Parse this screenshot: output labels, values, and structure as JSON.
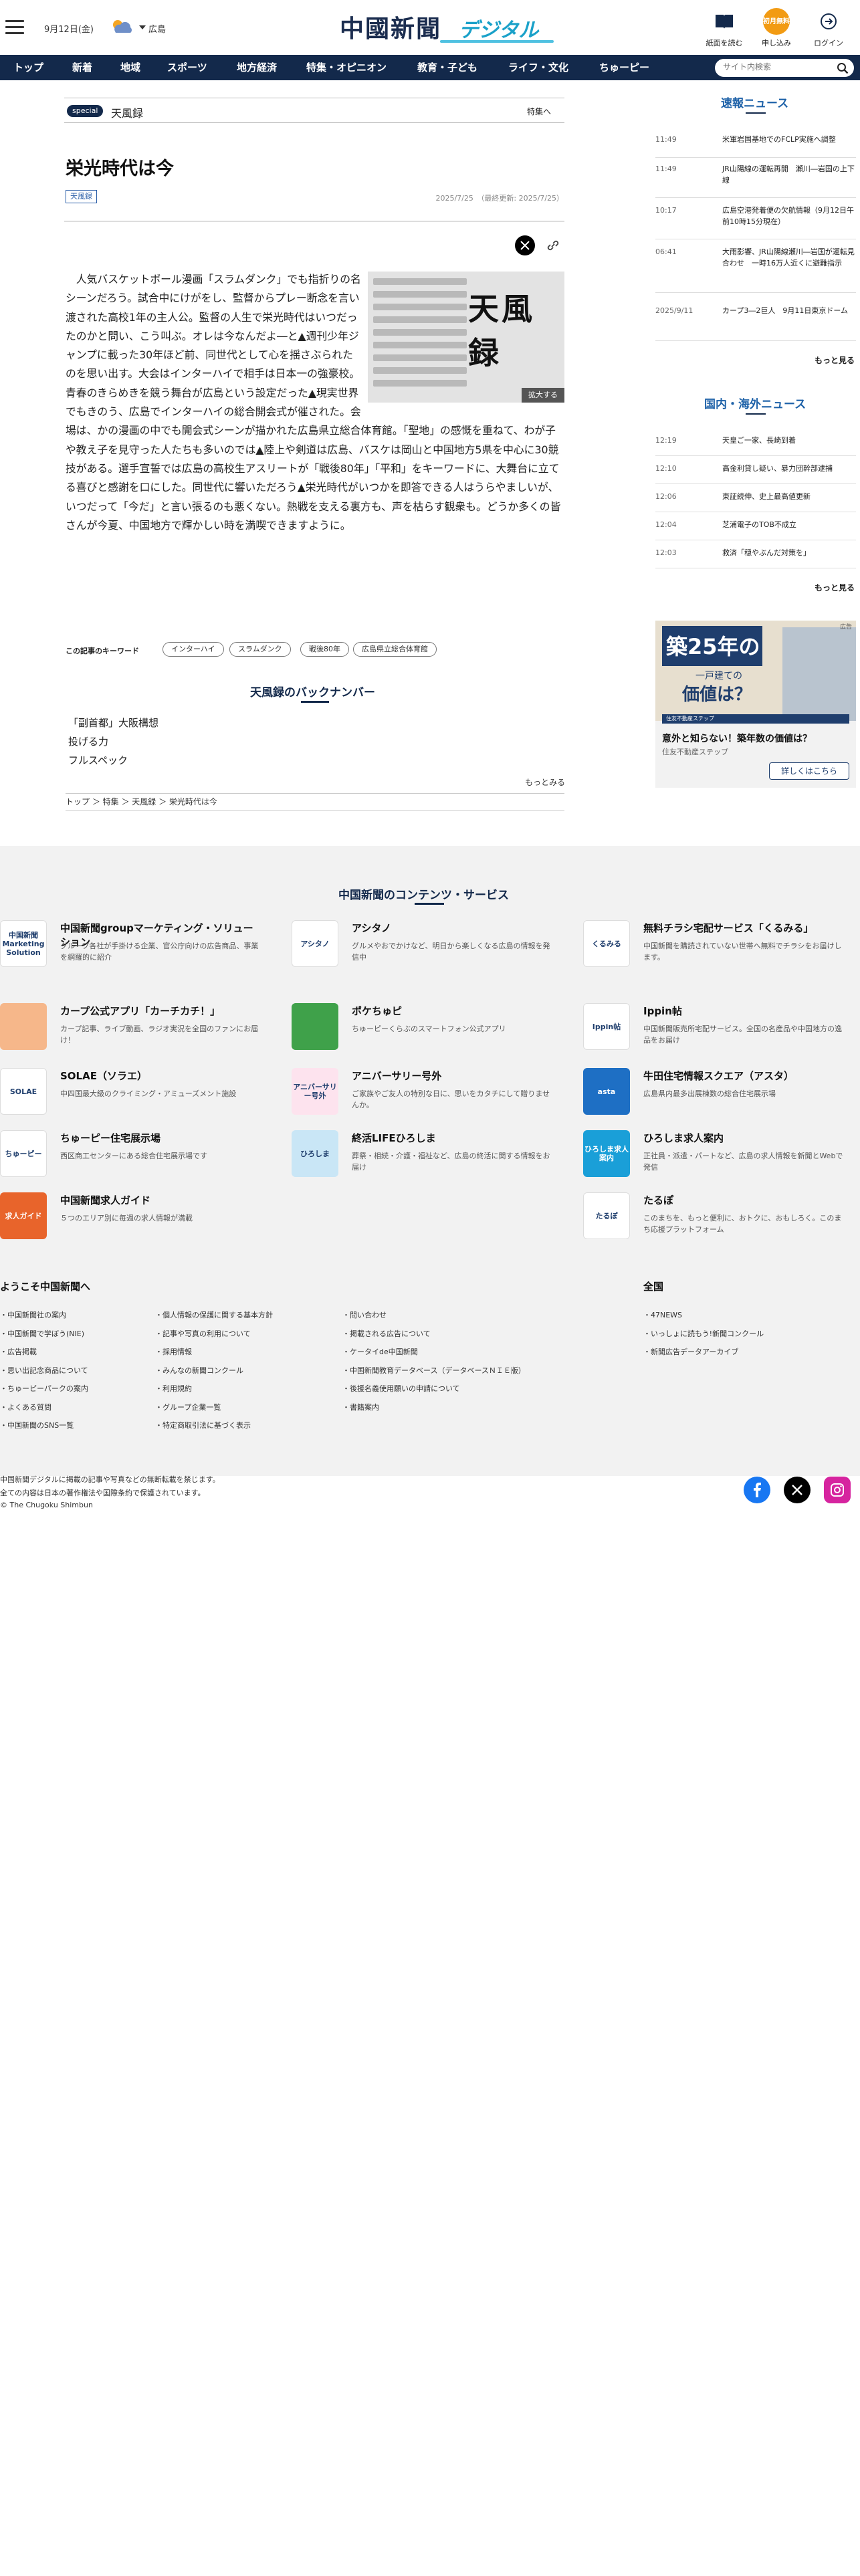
{
  "header": {
    "date": "9月12日(金)",
    "location": "広島",
    "logo_main": "中國新聞",
    "logo_sub": "デジタル",
    "btn_paper": "紙面を読む",
    "btn_apply": "申し込み",
    "btn_apply_badge": "初月無料",
    "btn_login": "ログイン"
  },
  "nav": {
    "items": [
      "トップ",
      "新着",
      "地域",
      "スポーツ",
      "地方経済",
      "特集・オピニオン",
      "教育・子ども",
      "ライフ・文化",
      "ちゅーピー"
    ],
    "search_placeholder": "サイト内検索"
  },
  "article": {
    "special_badge": "special",
    "section": "天風録",
    "feature_link": "特集へ",
    "title": "栄光時代は今",
    "tag": "天風録",
    "date": "2025/7/25",
    "updated": "（最終更新: 2025/7/25）",
    "photo_text": "天風録",
    "zoom": "拡大する",
    "body": "人気バスケットボール漫画「スラムダンク」でも指折りの名シーンだろう。試合中にけがをし、監督からプレー断念を言い渡された高校1年の主人公。監督の人生で栄光時代はいつだったのかと問い、こう叫ぶ。オレは今なんだよ―と▲週刊少年ジャンプに載った30年ほど前、同世代として心を揺さぶられたのを思い出す。大会はインターハイで相手は日本一の強豪校。青春のきらめきを競う舞台が広島という設定だった▲現実世界でもきのう、広島でインターハイの総合開会式が催された。会場は、かの漫画の中でも開会式シーンが描かれた広島県立総合体育館。「聖地」の感慨を重ねて、わが子や教え子を見守った人たちも多いのでは▲陸上や剣道は広島、バスケは岡山と中国地方5県を中心に30競技がある。選手宣誓では広島の高校生アスリートが「戦後80年」「平和」をキーワードに、大舞台に立てる喜びと感謝を口にした。同世代に響いただろう▲栄光時代がいつかを即答できる人はうらやましいが、いつだって「今だ」と言い張るのも悪くない。熱戦を支える裏方も、声を枯らす観衆も。どうか多くの皆さんが今夏、中国地方で輝かしい時を満喫できますように。",
    "keywords_label": "この記事のキーワード",
    "keywords": [
      "インターハイ",
      "スラムダンク",
      "戦後80年",
      "広島県立総合体育館"
    ],
    "backnumber_title": "天風録のバックナンバー",
    "backnumbers": [
      "「副首都」大阪構想",
      "投げる力",
      "フルスペック"
    ],
    "more": "もっとみる",
    "breadcrumb": "トップ ＞ 特集 ＞ 天風録 ＞ 栄光時代は今"
  },
  "sidebar": {
    "breaking_title": "速報ニュース",
    "breaking": [
      {
        "time": "11:49",
        "headline": "米軍岩国基地でのFCLP実施へ調整"
      },
      {
        "time": "11:49",
        "headline": "JR山陽線の運転再開　瀬川―岩国の上下線"
      },
      {
        "time": "10:17",
        "headline": "広島空港発着便の欠航情報（9月12日午前10時15分現在）"
      },
      {
        "time": "06:41",
        "headline": "大雨影響、JR山陽線瀬川―岩国が運転見合わせ　一時16万人近くに避難指示"
      },
      {
        "time": "2025/9/11",
        "headline": "カープ3―2巨人　9月11日東京ドーム"
      }
    ],
    "more": "もっと見る",
    "intl_title": "国内・海外ニュース",
    "intl": [
      {
        "time": "12:19",
        "headline": "天皇ご一家、長崎到着"
      },
      {
        "time": "12:10",
        "headline": "高金利貸し疑い、暴力団幹部逮捕"
      },
      {
        "time": "12:06",
        "headline": "東証続伸、史上最高値更新"
      },
      {
        "time": "12:04",
        "headline": "芝浦電子のTOB不成立"
      },
      {
        "time": "12:03",
        "headline": "救済「穏やぶんだ対策を」"
      }
    ],
    "ad": {
      "label": "広告",
      "headline": "築25年の",
      "sub": "一戸建ての",
      "question": "価値は？",
      "bar": "住友不動産ステップ",
      "copy": "意外と知らない！築年数の価値は？",
      "brand": "住友不動産ステップ",
      "cta": "詳しくはこちら"
    }
  },
  "services": {
    "title": "中国新聞のコンテンツ・サービス",
    "items": [
      {
        "name": "中国新聞groupマーケティング・ソリューション",
        "desc": "グループ各社が手掛ける企業、官公庁向けの広告商品、事業を網羅的に紹介",
        "icon_text": "中国新聞 Marketing Solution",
        "color": "#ffffff"
      },
      {
        "name": "アシタノ",
        "desc": "グルメやおでかけなど、明日から楽しくなる広島の情報を発信中",
        "icon_text": "アシタノ",
        "color": "#ffffff"
      },
      {
        "name": "無料チラシ宅配サービス「くるみる」",
        "desc": "中国新聞を購読されていない世帯へ無料でチラシをお届けします。",
        "icon_text": "くるみる",
        "color": "#ffffff"
      },
      {
        "name": "カープ公式アプリ「カーチカチ！」",
        "desc": "カープ記事、ライブ動画、ラジオ実況を全国のファンにお届け！",
        "icon_text": "",
        "color": "#f6b78a"
      },
      {
        "name": "ポケちゅピ",
        "desc": "ちゅーピーくらぶのスマートフォン公式アプリ",
        "icon_text": "",
        "color": "#3fa14a"
      },
      {
        "name": "Ippin帖",
        "desc": "中国新聞販売所宅配サービス。全国の名産品や中国地方の逸品をお届け",
        "icon_text": "Ippin帖",
        "color": "#ffffff"
      },
      {
        "name": "SOLAE（ソラエ）",
        "desc": "中四国最大級のクライミング・アミューズメント施設",
        "icon_text": "SOLAE",
        "color": "#ffffff"
      },
      {
        "name": "アニバーサリー号外",
        "desc": "ご家族やご友人の特別な日に、思いをカタチにして贈りませんか。",
        "icon_text": "アニバーサリー号外",
        "color": "#fde3ee"
      },
      {
        "name": "牛田住宅情報スクエア（アスタ）",
        "desc": "広島県内最多出展棟数の総合住宅展示場",
        "icon_text": "asta",
        "color": "#1e6fc4"
      },
      {
        "name": "ちゅーピー住宅展示場",
        "desc": "西区商工センターにある総合住宅展示場です",
        "icon_text": "ちゅーピー",
        "color": "#ffffff"
      },
      {
        "name": "終活LIFEひろしま",
        "desc": "葬祭・相続・介護・福祉など、広島の終活に関する情報をお届け",
        "icon_text": "ひろしま",
        "color": "#c9e6f6"
      },
      {
        "name": "ひろしま求人案内",
        "desc": "正社員・派遣・パートなど、広島の求人情報を新聞とWebで発信",
        "icon_text": "ひろしま求人案内",
        "color": "#1a9fd8"
      },
      {
        "name": "中国新聞求人ガイド",
        "desc": "５つのエリア別に毎週の求人情報が満載",
        "icon_text": "求人ガイド",
        "color": "#e8642b"
      },
      {
        "name": "",
        "desc": "",
        "icon_text": "",
        "color": ""
      },
      {
        "name": "たるぽ",
        "desc": "このまちを、もっと便利に、おトクに、おもしろく。このまち応援プラットフォーム",
        "icon_text": "たるぽ",
        "color": "#ffffff"
      }
    ]
  },
  "footer": {
    "welcome": "ようこそ中国新聞へ",
    "col1": [
      "中国新聞社の案内",
      "中国新聞で学ぼう(NIE)",
      "広告掲載",
      "思い出記念商品について",
      "ちゅーピーパークの案内",
      "よくある質問",
      "中国新聞のSNS一覧"
    ],
    "col2": [
      "個人情報の保護に関する基本方針",
      "記事や写真の利用について",
      "採用情報",
      "みんなの新聞コンクール",
      "利用規約",
      "グループ企業一覧",
      "特定商取引法に基づく表示"
    ],
    "col3": [
      "問い合わせ",
      "掲載される広告について",
      "ケータイde中国新聞",
      "中国新聞教育データベース（データベースＮＩＥ版）",
      "後援名義使用願いの申請について",
      "書籍案内"
    ],
    "national": "全国",
    "col4": [
      "47NEWS",
      "いっしょに読もう!新聞コンクール",
      "新聞広告データアーカイブ"
    ],
    "copy1": "中国新聞デジタルに掲載の記事や写真などの無断転載を禁じます。",
    "copy2": "全ての内容は日本の著作権法や国際条約で保護されています。",
    "copy3": "© The Chugoku Shimbun"
  }
}
